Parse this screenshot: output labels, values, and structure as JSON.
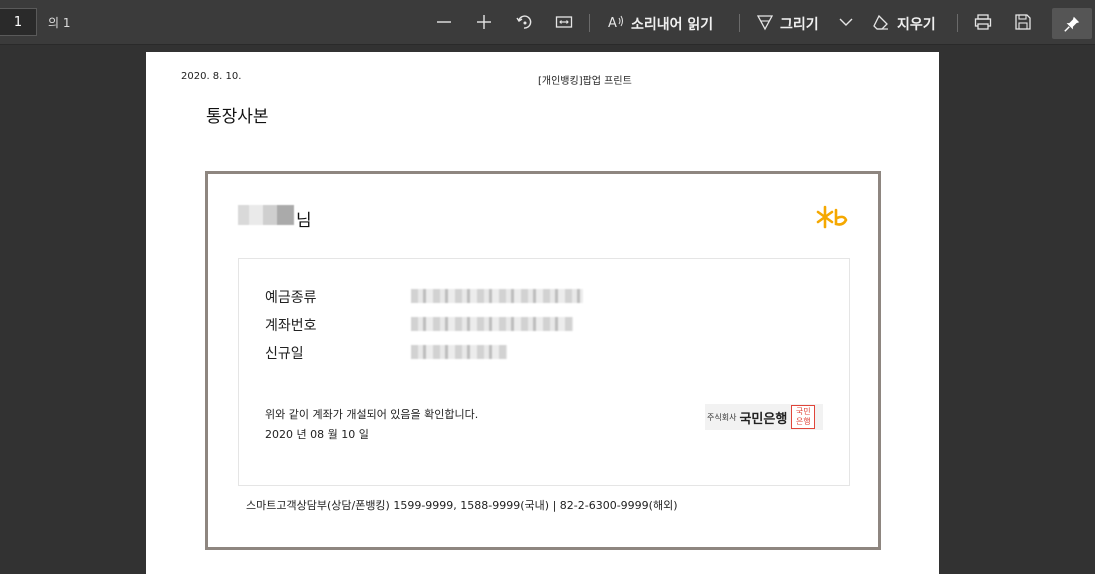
{
  "toolbar": {
    "page_current": "1",
    "page_total": "의 1",
    "read_aloud_label": "소리내어 읽기",
    "draw_label": "그리기",
    "erase_label": "지우기",
    "icons": [
      "minus-icon",
      "plus-icon",
      "rotate-icon",
      "fit-page-icon",
      "read-aloud-icon",
      "draw-icon",
      "chevron-down-icon",
      "eraser-icon",
      "print-icon",
      "save-icon",
      "pin-icon"
    ]
  },
  "document": {
    "header_date": "2020. 8. 10.",
    "header_title": "[개인뱅킹]팝업 프린트",
    "title": "통장사본",
    "name_suffix": "님",
    "fields": [
      {
        "label": "예금종류"
      },
      {
        "label": "계좌번호"
      },
      {
        "label": "신규일"
      }
    ],
    "confirm_text": "위와 같이 계좌가 개설되어 있음을 확인합니다.",
    "confirm_date": "2020 년 08 월 10 일",
    "bank_small": "주식회사",
    "bank_name": "국민은행",
    "seal_line1": "국민",
    "seal_line2": "은행",
    "footer": "스마트고객상담부(상담/폰뱅킹) 1599-9999, 1588-9999(국내) | 82-2-6300-9999(해외)",
    "brand_color": "#f5a800",
    "seal_color": "#e0453a"
  }
}
